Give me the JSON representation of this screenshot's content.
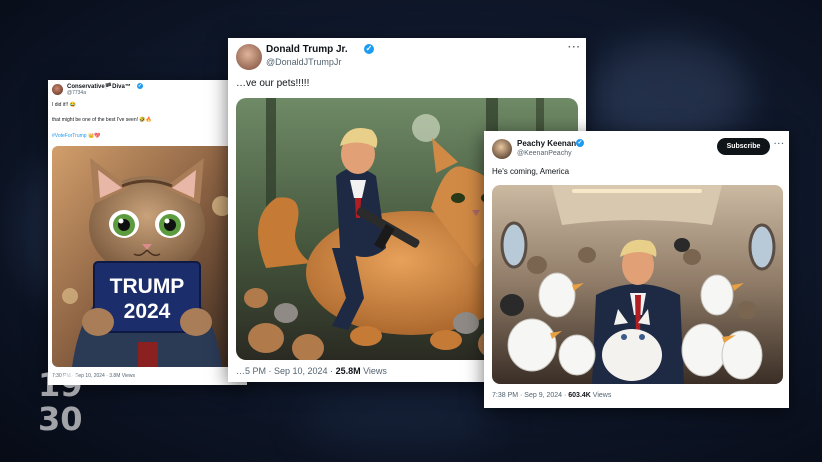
{
  "background_color": "#101a2e",
  "accent_color": "#1d9bf0",
  "posts": {
    "left": {
      "display_name": "Conservative🏴Diva™",
      "handle": "@7734a",
      "line1": "I did it!! 😂",
      "line2": "that might be one of the best I've seen! 🤣🔥",
      "hashtag": "#VoteForTrump 👑💖",
      "sign_line1": "TRUMP",
      "sign_line2": "2024",
      "timestamp": "7:30 PM · Sep 10, 2024 · 3.8M Views",
      "verified_icon": "verified-badge-icon"
    },
    "center": {
      "display_name": "Donald Trump Jr.",
      "handle": "@DonaldJTrumpJr",
      "text": "…ve our pets!!!!!",
      "time_date": "…5 PM · Sep 10, 2024 · ",
      "views_count": "25.8M",
      "views_label": " Views",
      "verified_icon": "verified-badge-icon"
    },
    "right": {
      "display_name": "Peachy Keenan",
      "handle": "@KeenanPeachy",
      "subscribe_label": "Subscribe",
      "text": "He's coming, America",
      "time_date": "7:38 PM · Sep 9, 2024 · ",
      "views_count": "603.4K",
      "views_label": " Views",
      "verified_icon": "verified-badge-icon"
    }
  },
  "broadcast_logo": {
    "line1": "19",
    "line2": "30"
  }
}
